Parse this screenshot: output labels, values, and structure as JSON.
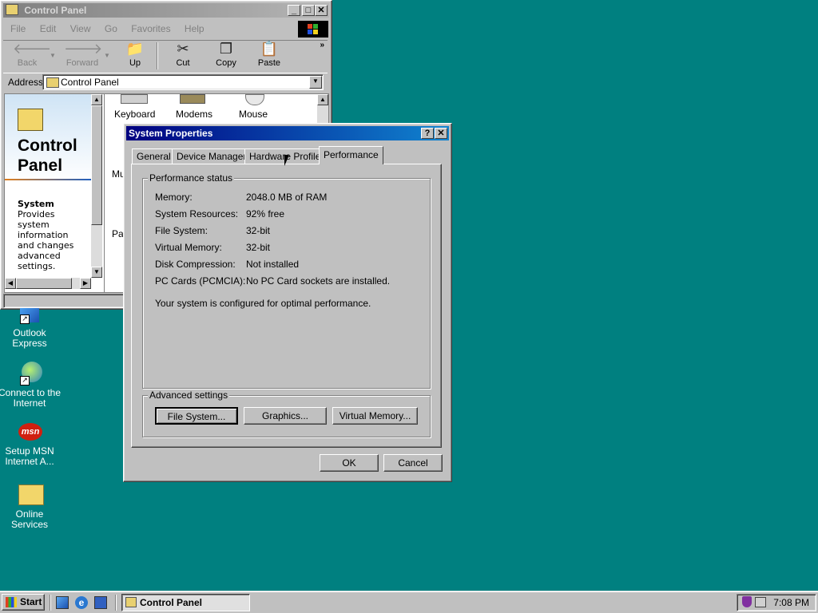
{
  "control_panel": {
    "title": "Control Panel",
    "menu": [
      "File",
      "Edit",
      "View",
      "Go",
      "Favorites",
      "Help"
    ],
    "toolbar": {
      "back": "Back",
      "forward": "Forward",
      "up": "Up",
      "cut": "Cut",
      "copy": "Copy",
      "paste": "Paste"
    },
    "address_label": "Address",
    "address_value": "Control Panel",
    "heading_line1": "Control",
    "heading_line2": "Panel",
    "selected_name": "System",
    "selected_desc": "Provides system information and changes advanced settings.",
    "items": [
      "Keyboard",
      "Modems",
      "Mouse",
      "Mu",
      "Pa"
    ]
  },
  "dialog": {
    "title": "System Properties",
    "tabs": [
      "General",
      "Device Manager",
      "Hardware Profiles",
      "Performance"
    ],
    "status_group": "Performance status",
    "rows": [
      {
        "label": "Memory:",
        "value": "2048.0 MB of RAM"
      },
      {
        "label": "System Resources:",
        "value": "92% free"
      },
      {
        "label": "File System:",
        "value": "32-bit"
      },
      {
        "label": "Virtual Memory:",
        "value": "32-bit"
      },
      {
        "label": "Disk Compression:",
        "value": "Not installed"
      },
      {
        "label": "PC Cards (PCMCIA):",
        "value": "No PC Card sockets are installed."
      }
    ],
    "summary": "Your system is configured for optimal performance.",
    "advanced_group": "Advanced settings",
    "file_system_btn": "File System...",
    "graphics_btn": "Graphics...",
    "virtual_memory_btn": "Virtual Memory...",
    "ok": "OK",
    "cancel": "Cancel"
  },
  "desktop_icons": [
    {
      "label_line1": "Outlook",
      "label_line2": "Express",
      "icon": "outlook-express-icon"
    },
    {
      "label_line1": "Connect to the",
      "label_line2": "Internet",
      "icon": "connect-internet-icon"
    },
    {
      "label_line1": "Setup MSN",
      "label_line2": "Internet A...",
      "icon": "msn-icon"
    },
    {
      "label_line1": "Online",
      "label_line2": "Services",
      "icon": "folder-icon"
    }
  ],
  "taskbar": {
    "start": "Start",
    "task": "Control Panel",
    "clock": "7:08 PM"
  },
  "colors": {
    "desktop": "#008080",
    "active_title": "#000080",
    "face": "#c0c0c0"
  }
}
